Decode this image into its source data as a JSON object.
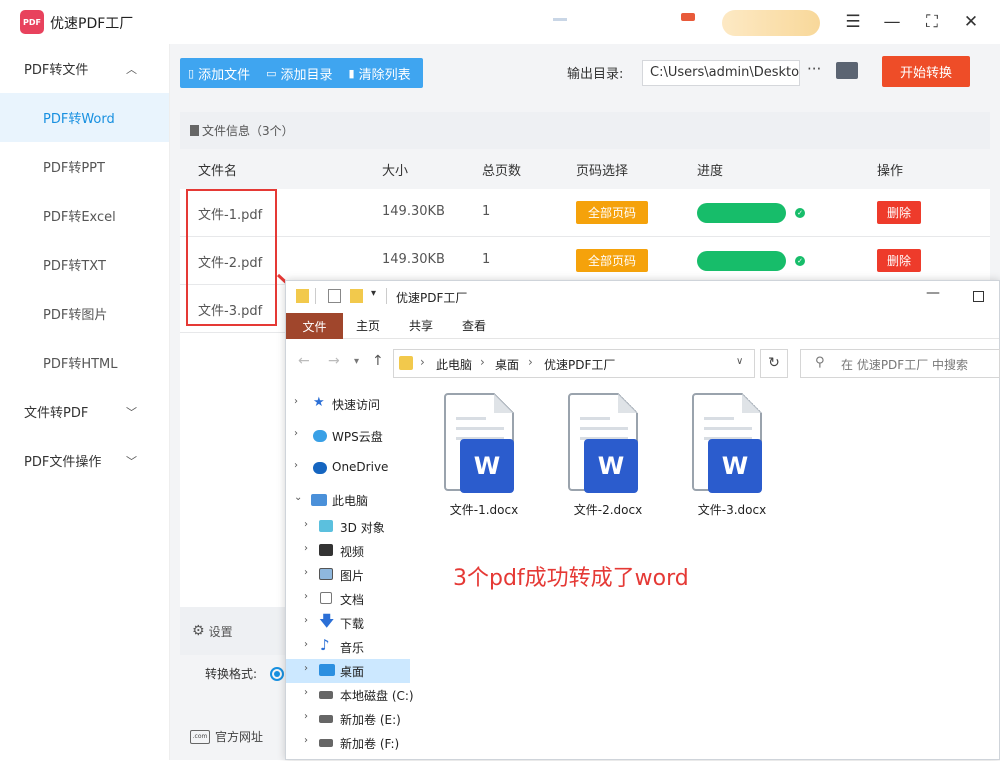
{
  "app": {
    "logo_text": "PDF",
    "title": "优速PDF工厂"
  },
  "sidebar": {
    "groups": [
      {
        "label": "PDF转文件",
        "expanded": true
      },
      {
        "label": "文件转PDF",
        "expanded": false
      },
      {
        "label": "PDF文件操作",
        "expanded": false
      }
    ],
    "items": [
      {
        "label": "PDF转Word",
        "active": true
      },
      {
        "label": "PDF转PPT"
      },
      {
        "label": "PDF转Excel"
      },
      {
        "label": "PDF转TXT"
      },
      {
        "label": "PDF转图片"
      },
      {
        "label": "PDF转HTML"
      }
    ]
  },
  "toolbar": {
    "add_file": "添加文件",
    "add_dir": "添加目录",
    "clear_list": "清除列表",
    "output_label": "输出目录:",
    "output_path": "C:\\Users\\admin\\Deskto",
    "more": "···",
    "start": "开始转换"
  },
  "file_panel": {
    "header": "文件信息（3个）",
    "columns": [
      "文件名",
      "大小",
      "总页数",
      "页码选择",
      "进度",
      "操作"
    ],
    "rows": [
      {
        "name": "文件-1.pdf",
        "size": "149.30KB",
        "pages": "1",
        "page_select": "全部页码",
        "progress": 1.0,
        "action": "删除"
      },
      {
        "name": "文件-2.pdf",
        "size": "149.30KB",
        "pages": "1",
        "page_select": "全部页码",
        "progress": 1.0,
        "action": "删除"
      },
      {
        "name": "文件-3.pdf"
      }
    ]
  },
  "settings": {
    "title": "设置",
    "format_label": "转换格式:"
  },
  "footer": {
    "site_icon": ".com",
    "site_link": "官方网址"
  },
  "explorer": {
    "title": "优速PDF工厂",
    "ribbon_tabs": [
      "文件",
      "主页",
      "共享",
      "查看"
    ],
    "breadcrumb": [
      "此电脑",
      "桌面",
      "优速PDF工厂"
    ],
    "search_placeholder": "在 优速PDF工厂 中搜索",
    "tree": [
      {
        "label": "快速访问",
        "icon": "star-icon",
        "level": 0
      },
      {
        "label": "WPS云盘",
        "icon": "cloud-icon",
        "level": 0
      },
      {
        "label": "OneDrive",
        "icon": "onedrive-icon",
        "level": 0
      },
      {
        "label": "此电脑",
        "icon": "computer-icon",
        "level": 0,
        "expanded": true
      },
      {
        "label": "3D 对象",
        "icon": "cube-icon",
        "level": 1
      },
      {
        "label": "视频",
        "icon": "video-icon",
        "level": 1
      },
      {
        "label": "图片",
        "icon": "picture-icon",
        "level": 1
      },
      {
        "label": "文档",
        "icon": "document-icon",
        "level": 1
      },
      {
        "label": "下载",
        "icon": "download-icon",
        "level": 1
      },
      {
        "label": "音乐",
        "icon": "music-icon",
        "level": 1
      },
      {
        "label": "桌面",
        "icon": "desktop-icon",
        "level": 1,
        "selected": true
      },
      {
        "label": "本地磁盘 (C:)",
        "icon": "drive-icon",
        "level": 1
      },
      {
        "label": "新加卷 (E:)",
        "icon": "drive-icon",
        "level": 1
      },
      {
        "label": "新加卷 (F:)",
        "icon": "drive-icon",
        "level": 1
      }
    ],
    "files": [
      {
        "name": "文件-1.docx",
        "badge": "W"
      },
      {
        "name": "文件-2.docx",
        "badge": "W"
      },
      {
        "name": "文件-3.docx",
        "badge": "W"
      }
    ]
  },
  "annotation": "3个pdf成功转成了word",
  "colors": {
    "accent_blue": "#3fa5f0",
    "start_red": "#ee4d28",
    "page_orange": "#f5a20b",
    "progress_green": "#17bd6a",
    "delete_red": "#ee3b2b",
    "annotation_red": "#e53935",
    "word_blue": "#2b5ccd"
  }
}
